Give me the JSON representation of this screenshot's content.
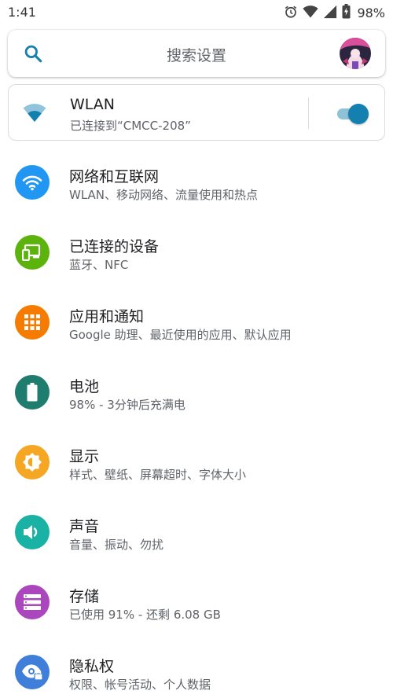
{
  "status_bar": {
    "time": "1:41",
    "battery_text": "98%",
    "icons": [
      "alarm-icon",
      "wifi-icon",
      "cellular-signal-icon",
      "battery-icon"
    ]
  },
  "search": {
    "placeholder": "搜索设置",
    "icon": "search-icon"
  },
  "wlan_card": {
    "title": "WLAN",
    "subtitle": "已连接到“CMCC-208”",
    "toggle_on": true,
    "accent": "#1380b0"
  },
  "settings": [
    {
      "title": "网络和互联网",
      "subtitle": "WLAN、移动网络、流量使用和热点",
      "icon": "wifi-icon",
      "color": "#2196f3"
    },
    {
      "title": "已连接的设备",
      "subtitle": "蓝牙、NFC",
      "icon": "devices-icon",
      "color": "#5cb30c"
    },
    {
      "title": "应用和通知",
      "subtitle": "Google 助理、最近使用的应用、默认应用",
      "icon": "apps-grid-icon",
      "color": "#f57c00"
    },
    {
      "title": "电池",
      "subtitle": "98% - 3分钟后充满电",
      "icon": "battery-icon",
      "color": "#1e7d6e"
    },
    {
      "title": "显示",
      "subtitle": "样式、壁纸、屏幕超时、字体大小",
      "icon": "brightness-icon",
      "color": "#f5a623"
    },
    {
      "title": "声音",
      "subtitle": "音量、振动、勿扰",
      "icon": "volume-icon",
      "color": "#1ab2a5"
    },
    {
      "title": "存储",
      "subtitle": "已使用 91% - 还剩 6.08 GB",
      "icon": "storage-icon",
      "color": "#ab47bc"
    },
    {
      "title": "隐私权",
      "subtitle": "权限、帐号活动、个人数据",
      "icon": "privacy-eye-icon",
      "color": "#3f7fd9"
    }
  ]
}
